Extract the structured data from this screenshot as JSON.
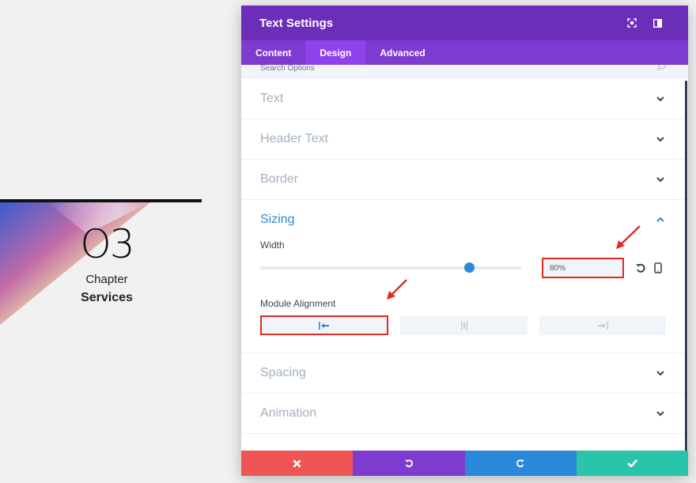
{
  "background": {
    "chapter_number": "O3",
    "chapter_label": "Chapter",
    "chapter_title": "Services"
  },
  "modal": {
    "title": "Text Settings",
    "header_icons": [
      "focus-icon",
      "sidebar-layout-icon"
    ],
    "tabs": [
      {
        "label": "Content",
        "active": false
      },
      {
        "label": "Design",
        "active": true
      },
      {
        "label": "Advanced",
        "active": false
      }
    ],
    "search": {
      "placeholder": "Search Options"
    },
    "sections": {
      "text": "Text",
      "header_text": "Header Text",
      "border": "Border",
      "sizing": "Sizing",
      "spacing": "Spacing",
      "animation": "Animation"
    },
    "sizing": {
      "width_label": "Width",
      "width_value": "80%",
      "width_fraction": 0.8,
      "module_alignment_label": "Module Alignment",
      "alignment_options": [
        "left",
        "center",
        "right"
      ],
      "alignment_selected": "left"
    },
    "footer": [
      "cancel",
      "undo",
      "redo",
      "save"
    ]
  },
  "colors": {
    "header": "#6c2eb9",
    "tabs": "#7e3bd0",
    "active_tab": "#8f42ec",
    "accent_blue": "#2b87da",
    "highlight_red": "#e02b20",
    "cancel": "#ef5555",
    "save": "#29c4a9"
  }
}
